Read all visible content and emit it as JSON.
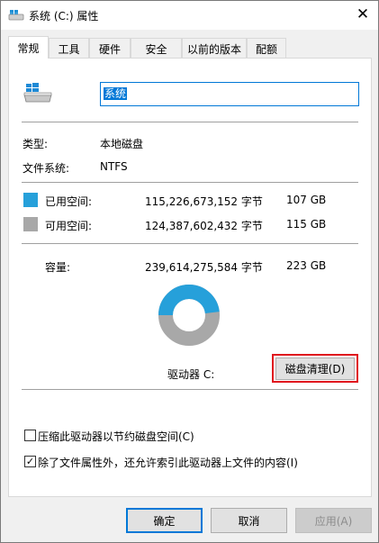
{
  "window": {
    "title": "系统 (C:) 属性",
    "close_glyph": "✕"
  },
  "tabs": [
    {
      "label": "常规",
      "active": true
    },
    {
      "label": "工具"
    },
    {
      "label": "硬件"
    },
    {
      "label": "安全"
    },
    {
      "label": "以前的版本"
    },
    {
      "label": "配额"
    }
  ],
  "general": {
    "name_value": "系统",
    "type_label": "类型:",
    "type_value": "本地磁盘",
    "fs_label": "文件系统:",
    "fs_value": "NTFS",
    "used": {
      "label": "已用空间:",
      "bytes": "115,226,673,152 字节",
      "size": "107 GB",
      "color": "#26a0da"
    },
    "free": {
      "label": "可用空间:",
      "bytes": "124,387,602,432 字节",
      "size": "115 GB",
      "color": "#a8a8a8"
    },
    "capacity": {
      "label": "容量:",
      "bytes": "239,614,275,584 字节",
      "size": "223 GB"
    },
    "used_fraction": 0.4809,
    "drive_label": "驱动器 C:",
    "cleanup_button": "磁盘清理(D)",
    "compress": {
      "label": "压缩此驱动器以节约磁盘空间(C)",
      "checked": false
    },
    "index": {
      "label": "除了文件属性外，还允许索引此驱动器上文件的内容(I)",
      "checked": true
    },
    "check_glyph": "✓"
  },
  "footer": {
    "ok": "确定",
    "cancel": "取消",
    "apply": "应用(A)"
  }
}
